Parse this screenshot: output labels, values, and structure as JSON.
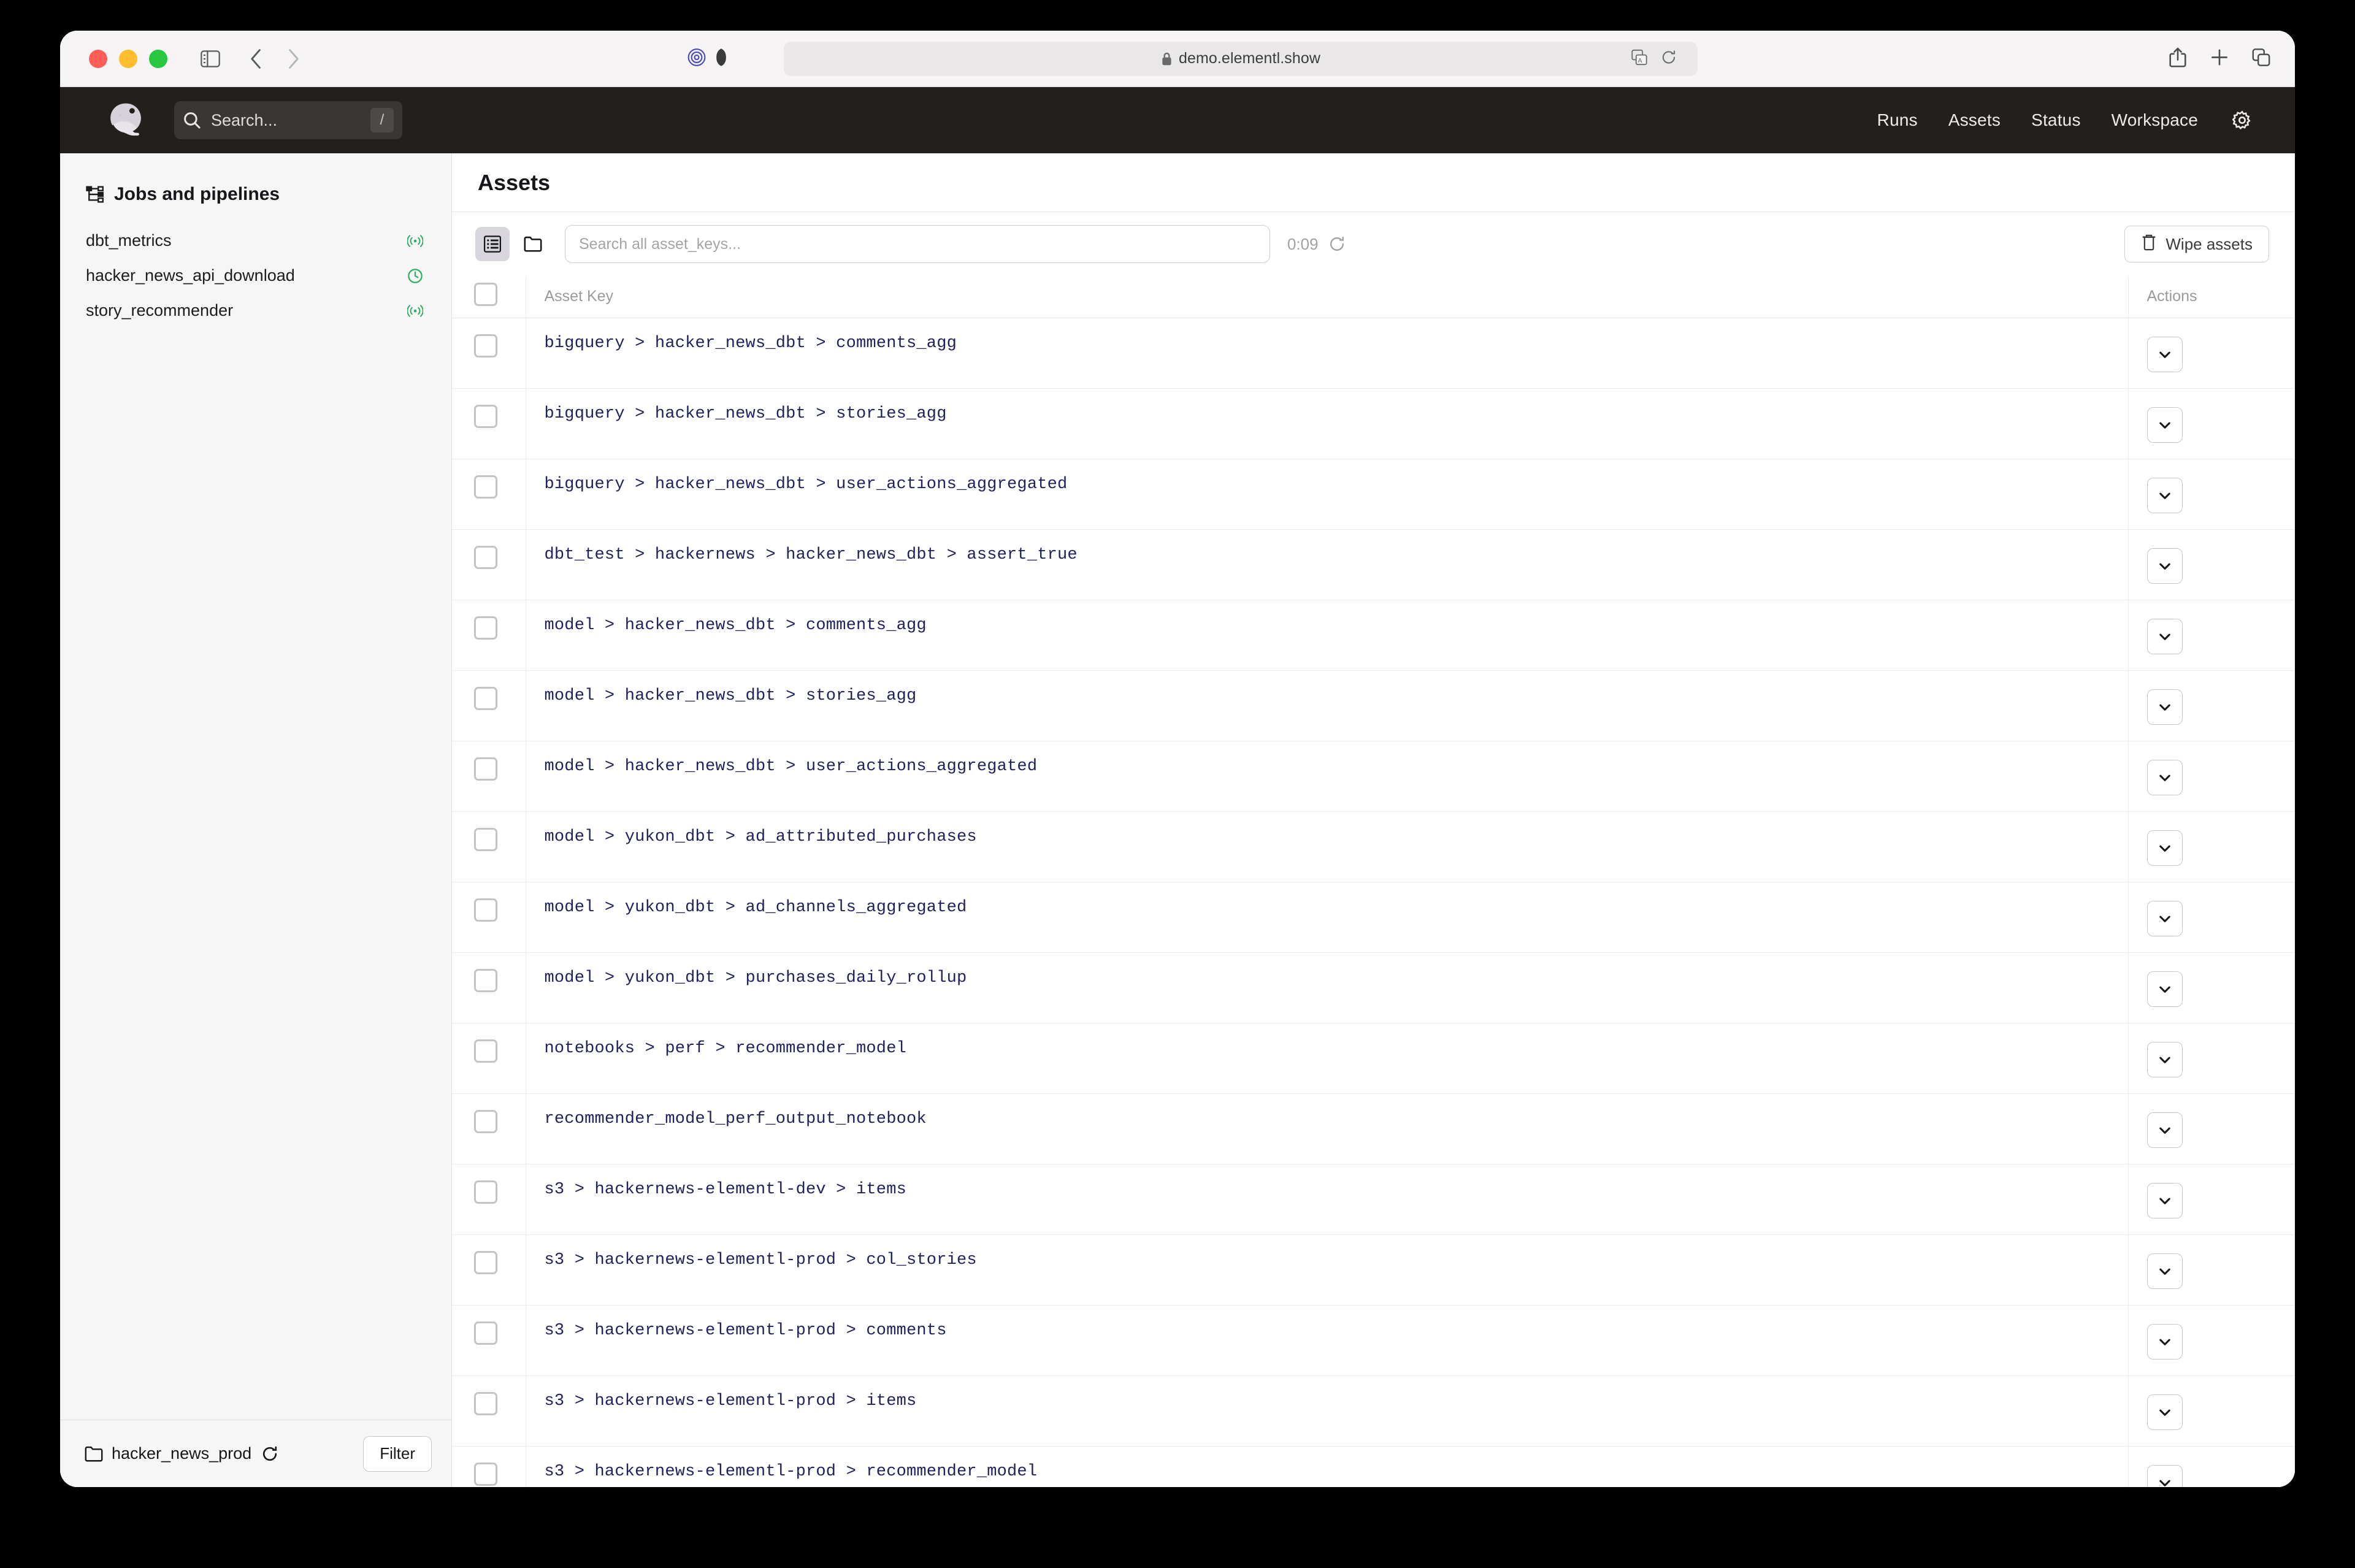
{
  "browser": {
    "url": "demo.elementl.show",
    "lock_icon": "lock-icon",
    "back_icon": "chevron-left-icon",
    "forward_icon": "chevron-right-icon",
    "sidebar_icon": "sidebar-toggle-icon",
    "shield_icon": "shield-icon",
    "reader_icon": "reader-view-icon",
    "translate_icon": "translate-icon",
    "reload_icon": "reload-icon",
    "share_icon": "share-icon",
    "new_tab_icon": "plus-icon",
    "tabs_icon": "tab-overview-icon"
  },
  "topnav": {
    "logo_icon": "dagster-logo-icon",
    "search": {
      "placeholder": "Search...",
      "icon": "search-icon",
      "shortcut": "/"
    },
    "links": [
      "Runs",
      "Assets",
      "Status",
      "Workspace"
    ],
    "settings_icon": "gear-icon"
  },
  "sidebar": {
    "header": {
      "label": "Jobs and pipelines",
      "icon": "sitemap-icon"
    },
    "items": [
      {
        "label": "dbt_metrics",
        "status_icon": "sensor-icon"
      },
      {
        "label": "hacker_news_api_download",
        "status_icon": "schedule-clock-icon"
      },
      {
        "label": "story_recommender",
        "status_icon": "sensor-icon"
      }
    ],
    "footer": {
      "folder_icon": "folder-icon",
      "label": "hacker_news_prod",
      "refresh_icon": "refresh-icon",
      "filter_label": "Filter"
    }
  },
  "main": {
    "title": "Assets",
    "toolbar": {
      "flat_view_icon": "list-view-icon",
      "folder_view_icon": "folder-view-icon",
      "search_placeholder": "Search all asset_keys...",
      "search_value": "",
      "timer": "0:09",
      "timer_refresh_icon": "refresh-icon",
      "wipe_label": "Wipe assets",
      "wipe_icon": "trash-icon"
    },
    "table": {
      "columns": [
        "Asset Key",
        "Actions"
      ],
      "row_action_icon": "chevron-down-icon",
      "rows": [
        {
          "key": "bigquery > hacker_news_dbt > comments_agg"
        },
        {
          "key": "bigquery > hacker_news_dbt > stories_agg"
        },
        {
          "key": "bigquery > hacker_news_dbt > user_actions_aggregated"
        },
        {
          "key": "dbt_test > hackernews > hacker_news_dbt > assert_true"
        },
        {
          "key": "model > hacker_news_dbt > comments_agg"
        },
        {
          "key": "model > hacker_news_dbt > stories_agg"
        },
        {
          "key": "model > hacker_news_dbt > user_actions_aggregated"
        },
        {
          "key": "model > yukon_dbt > ad_attributed_purchases"
        },
        {
          "key": "model > yukon_dbt > ad_channels_aggregated"
        },
        {
          "key": "model > yukon_dbt > purchases_daily_rollup"
        },
        {
          "key": "notebooks > perf > recommender_model"
        },
        {
          "key": "recommender_model_perf_output_notebook"
        },
        {
          "key": "s3 > hackernews-elementl-dev > items"
        },
        {
          "key": "s3 > hackernews-elementl-prod > col_stories"
        },
        {
          "key": "s3 > hackernews-elementl-prod > comments"
        },
        {
          "key": "s3 > hackernews-elementl-prod > items"
        },
        {
          "key": "s3 > hackernews-elementl-prod > recommender_model"
        }
      ]
    }
  },
  "colors": {
    "nav_bg": "#231f1d",
    "asset_key_text": "#21215c",
    "status_green": "#2eae62",
    "accent_toggle": "#d8d6dc"
  }
}
